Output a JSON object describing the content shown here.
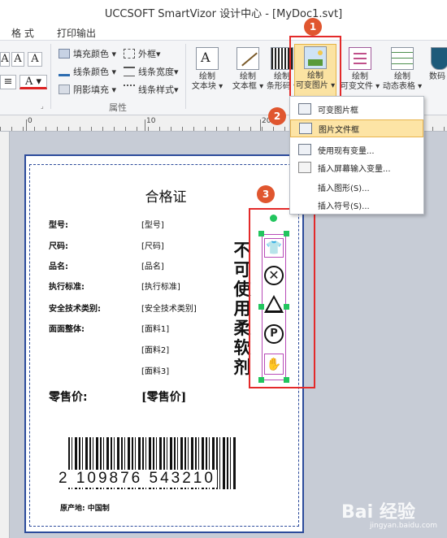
{
  "window": {
    "title": "UCCSOFT SmartVizor 设计中心 - [MyDoc1.svt]"
  },
  "menu": {
    "items": [
      "格 式",
      "打印输出"
    ]
  },
  "ribbon": {
    "format_rows": [
      {
        "label": "填充颜色 ▾",
        "icon": "fill-color-icon"
      },
      {
        "label": "线条颜色 ▾",
        "icon": "line-color-icon"
      },
      {
        "label": "阴影填充 ▾",
        "icon": "shadow-fill-icon"
      }
    ],
    "line_rows": [
      {
        "label": "外框▾",
        "icon": "border-icon"
      },
      {
        "label": "线条宽度▾",
        "icon": "line-width-icon"
      },
      {
        "label": "线条样式▾",
        "icon": "line-style-icon"
      }
    ],
    "group_label": "属性",
    "buttons": [
      {
        "label1": "绘制",
        "label2": "文本块 ▾"
      },
      {
        "label1": "绘制",
        "label2": "文本框 ▾"
      },
      {
        "label1": "绘制",
        "label2": "条形码 ▾"
      },
      {
        "label1": "绘制",
        "label2": "可变图片 ▾"
      },
      {
        "label1": "绘制",
        "label2": "可变文件 ▾"
      },
      {
        "label1": "绘制",
        "label2": "动态表格 ▾"
      },
      {
        "label1": "数码",
        "label2": ""
      }
    ]
  },
  "ruler": {
    "numbers": [
      "0",
      "10",
      "20"
    ]
  },
  "dropdown": {
    "items": [
      {
        "label": "可变图片框",
        "highlight": false
      },
      {
        "label": "图片文件框",
        "highlight": true
      },
      {
        "label": "使用现有变量...",
        "highlight": false
      },
      {
        "label": "插入屏幕输入变量...",
        "highlight": false
      },
      {
        "label": "插入图形(S)...",
        "highlight": false
      },
      {
        "label": "插入符号(S)...",
        "highlight": false
      }
    ]
  },
  "badges": [
    "1",
    "2",
    "3"
  ],
  "label_doc": {
    "title": "合格证",
    "fields": [
      {
        "name": "型号:",
        "value": "[型号]"
      },
      {
        "name": "尺码:",
        "value": "[尺码]"
      },
      {
        "name": "品名:",
        "value": "[品名]"
      },
      {
        "name": "执行标准:",
        "value": "[执行标准]"
      },
      {
        "name": "安全技术类别:",
        "value": "[安全技术类别]"
      },
      {
        "name": "面面整体:",
        "value": "[面料1]"
      }
    ],
    "extra_values": [
      "[面料2]",
      "[面料3]"
    ],
    "price_label": "零售价:",
    "price_value": "[零售价]",
    "vertical_text": "不可使用柔软剂",
    "barcode_digits": "2  109876  543210",
    "origin": "原产地: 中国制"
  },
  "care_icons": [
    "shirt-care-icon",
    "no-wash-icon",
    "triangle-bleach-icon",
    "p-dryclean-icon",
    "hand-wash-icon"
  ],
  "watermark": {
    "text": "Bai 经验",
    "url": "jingyan.baidu.com"
  },
  "colors": {
    "callout": "#e32a2a",
    "badge": "#e0562f",
    "highlight": "#fde4a5",
    "label_border": "#2c4b9b",
    "handle": "#22c55e"
  }
}
